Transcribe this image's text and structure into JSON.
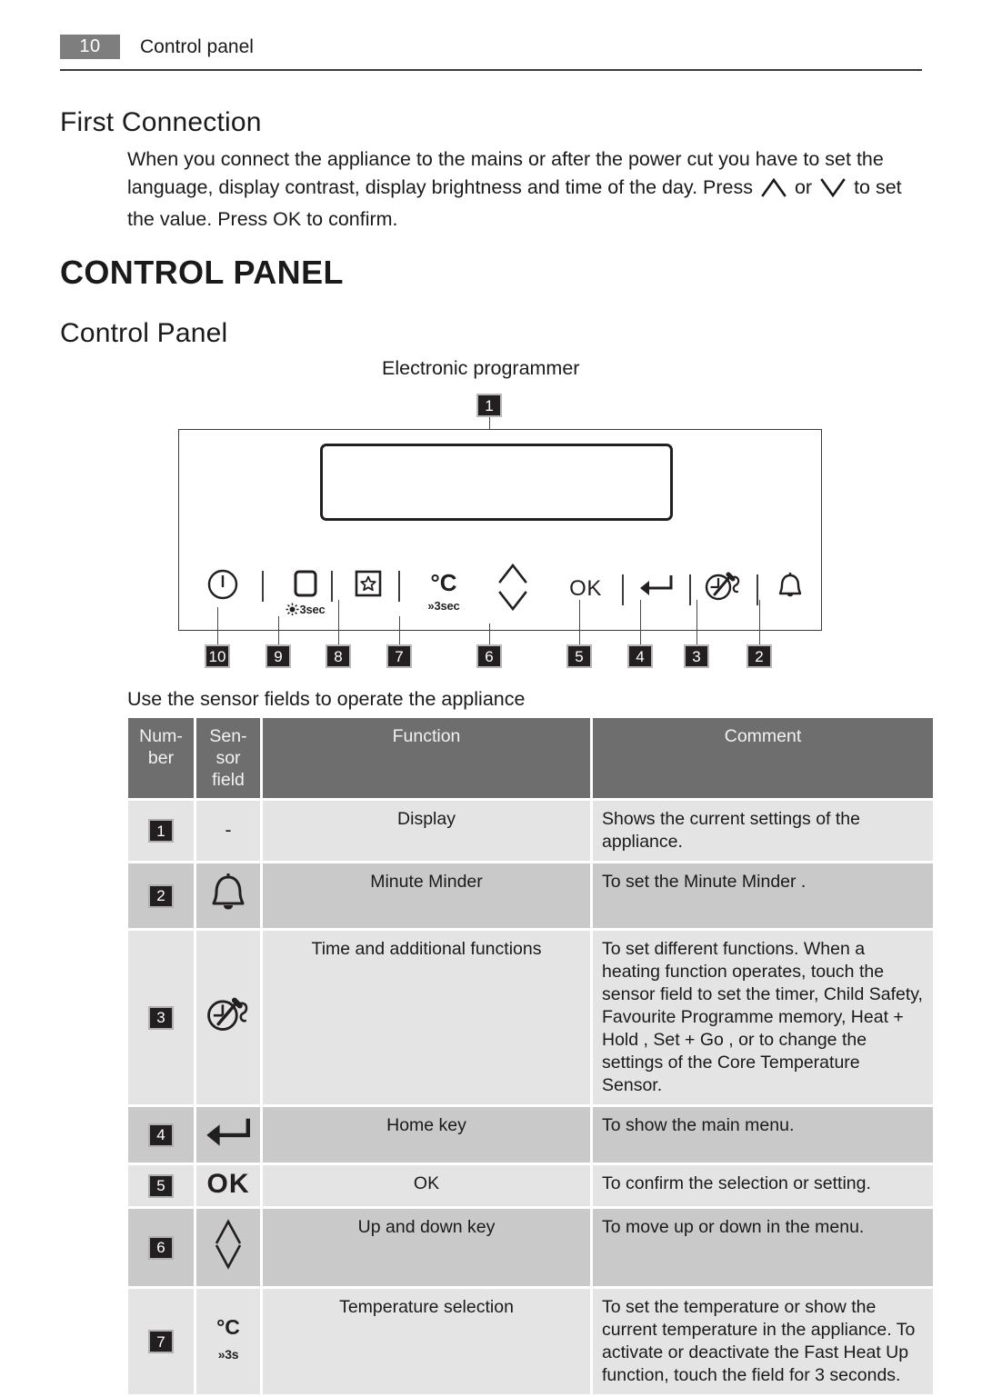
{
  "header": {
    "page_number": "10",
    "title": "Control panel"
  },
  "sections": {
    "first_connection": {
      "heading": "First Connection",
      "paragraph_part1": "When you connect the appliance to the mains or after the power cut you have to set the language, display contrast, display brightness and time of the day. Press",
      "paragraph_or": "or",
      "paragraph_part2": "to set the value. Press OK to confirm.",
      "up_icon": "chevron-up-icon",
      "down_icon": "chevron-down-icon"
    },
    "control_panel": {
      "title": "CONTROL PANEL",
      "heading": "Control Panel",
      "diagram_caption": "Electronic programmer",
      "instruction": "Use the sensor fields to operate the appliance"
    }
  },
  "diagram": {
    "display_callout": "1",
    "callouts_bottom": [
      "10",
      "9",
      "8",
      "7",
      "6",
      "5",
      "4",
      "3",
      "2"
    ],
    "sensor_fields": [
      {
        "id": "10",
        "icon": "power-icon",
        "sublabel": ""
      },
      {
        "id": "9",
        "icon": "rounded-square-icon",
        "sublabel": "3sec"
      },
      {
        "id": "8",
        "icon": "star-in-box-icon",
        "sublabel": ""
      },
      {
        "id": "7",
        "icon": "degree-celsius-icon",
        "label": "°C",
        "sublabel": "3sec"
      },
      {
        "id": "6",
        "icon": "up-down-chevron-icon",
        "sublabel": ""
      },
      {
        "id": "5",
        "icon": "ok-label",
        "label": "OK",
        "sublabel": ""
      },
      {
        "id": "4",
        "icon": "home-return-arrow-icon",
        "sublabel": ""
      },
      {
        "id": "3",
        "icon": "clock-probe-icon",
        "sublabel": ""
      },
      {
        "id": "2",
        "icon": "bell-icon",
        "sublabel": ""
      }
    ]
  },
  "table": {
    "headers": {
      "number": "Num-\nber",
      "number_line1": "Num-",
      "number_line2": "ber",
      "sensor_line1": "Sen-",
      "sensor_line2": "sor",
      "sensor_line3": "field",
      "function": "Function",
      "comment": "Comment"
    },
    "rows": [
      {
        "number": "1",
        "sensor_icon": "none",
        "sensor_text": "-",
        "function": "Display",
        "comment": "Shows the current settings of the appliance."
      },
      {
        "number": "2",
        "sensor_icon": "bell-icon",
        "sensor_text": "",
        "function": "Minute Minder",
        "comment": "To set the Minute Minder ."
      },
      {
        "number": "3",
        "sensor_icon": "clock-probe-icon",
        "sensor_text": "",
        "function": "Time and additional functions",
        "comment": "To set different functions. When a heating function operates, touch the sensor field to set the timer, Child Safety, Favourite Programme memory, Heat + Hold , Set + Go , or to change the settings of the Core Temperature Sensor."
      },
      {
        "number": "4",
        "sensor_icon": "home-return-arrow-icon",
        "sensor_text": "",
        "function": "Home key",
        "comment": "To show the main menu."
      },
      {
        "number": "5",
        "sensor_icon": "ok-label",
        "sensor_text": "OK",
        "function": "OK",
        "comment": "To confirm the selection or setting."
      },
      {
        "number": "6",
        "sensor_icon": "up-down-diamond-icon",
        "sensor_text": "",
        "function": "Up and down key",
        "comment": "To move up or down in the menu."
      },
      {
        "number": "7",
        "sensor_icon": "degree-celsius-icon",
        "sensor_text": "°C",
        "sensor_sub": "3s",
        "function": "Temperature selection",
        "comment": "To set the temperature or show the current temperature in the appliance. To activate or deactivate the Fast Heat Up function, touch the field for 3 seconds."
      }
    ]
  },
  "colors": {
    "header_badge_bg": "#7e7e7e",
    "table_header_bg": "#6e6e6e",
    "row_light": "#e4e4e4",
    "row_dark": "#c9c9c9",
    "callout_bg": "#231f20",
    "ink": "#1a1a1a"
  }
}
